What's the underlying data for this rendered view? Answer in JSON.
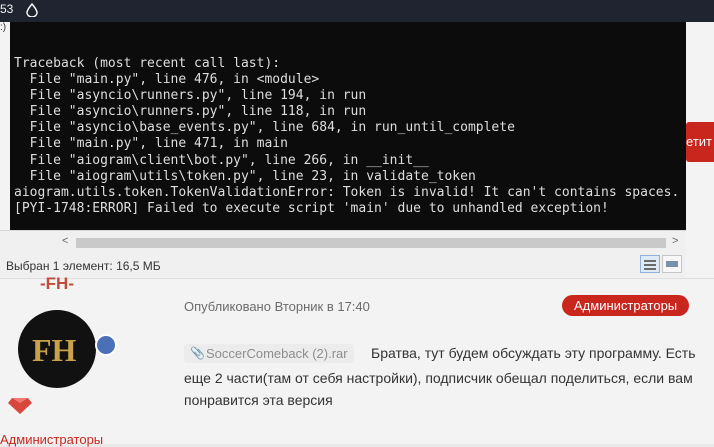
{
  "topbar": {
    "number": "53"
  },
  "console": {
    "corner_text": ":)",
    "lines": [
      "Traceback (most recent call last):",
      "  File \"main.py\", line 476, in <module>",
      "  File \"asyncio\\runners.py\", line 194, in run",
      "  File \"asyncio\\runners.py\", line 118, in run",
      "  File \"asyncio\\base_events.py\", line 684, in run_until_complete",
      "  File \"main.py\", line 471, in main",
      "  File \"aiogram\\client\\bot.py\", line 266, in __init__",
      "  File \"aiogram\\utils\\token.py\", line 23, in validate_token",
      "aiogram.utils.token.TokenValidationError: Token is invalid! It can't contains spaces.",
      "[PYI-1748:ERROR] Failed to execute script 'main' due to unhandled exception!"
    ]
  },
  "explorer": {
    "status": "Выбран 1 элемент: 16,5 МБ"
  },
  "forum": {
    "side_button": "етит",
    "author": "-FH-",
    "avatar_text": "FH",
    "role": "Администраторы",
    "posted": "Опубликовано Вторник в 17:40",
    "group_badge": "Администраторы",
    "attachment": "SoccerComeback (2).rar",
    "post_lines": [
      "Братва, тут будем обсуждать эту программу. Есть",
      "еще 2 части(там от себя настройки), подписчик обещал поделиться, если вам",
      "понравится эта версия"
    ]
  },
  "colors": {
    "accent": "#c9261e",
    "console_bg": "#0c0c0c",
    "author": "#c14b3b"
  }
}
